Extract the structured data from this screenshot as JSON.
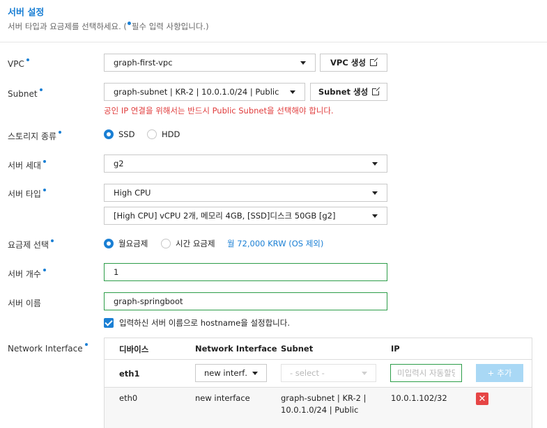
{
  "header": {
    "title": "서버 설정",
    "subtitle_pre": "서버 타입과 요금제를 선택하세요. (",
    "subtitle_post": "필수 입력 사항입니다.)"
  },
  "form": {
    "vpc": {
      "label": "VPC",
      "value": "graph-first-vpc",
      "create_button": "VPC 생성"
    },
    "subnet": {
      "label": "Subnet",
      "value": "graph-subnet | KR-2 | 10.0.1.0/24 | Public",
      "create_button": "Subnet 생성",
      "warning": "공인 IP 연결을 위해서는 반드시 Public Subnet을 선택해야 합니다."
    },
    "storage": {
      "label": "스토리지 종류",
      "options": [
        "SSD",
        "HDD"
      ],
      "selected": "SSD"
    },
    "generation": {
      "label": "서버 세대",
      "value": "g2"
    },
    "server_type": {
      "label": "서버 타입",
      "value": "High CPU",
      "spec_value": "[High CPU] vCPU 2개, 메모리 4GB, [SSD]디스크 50GB [g2]"
    },
    "billing": {
      "label": "요금제 선택",
      "options": [
        "월요금제",
        "시간 요금제"
      ],
      "selected": "월요금제",
      "price": "월 72,000 KRW (OS 제외)"
    },
    "server_count": {
      "label": "서버 개수",
      "value": "1"
    },
    "server_name": {
      "label": "서버 이름",
      "value": "graph-springboot",
      "hostname_checkbox_label": "입력하신 서버 이름으로 hostname을 설정합니다.",
      "hostname_checked": true
    },
    "network_interface": {
      "label": "Network Interface",
      "columns": [
        "디바이스",
        "Network Interface",
        "Subnet",
        "IP"
      ],
      "new_row": {
        "device": "eth1",
        "interface_select": "new interf…",
        "subnet_placeholder": "- select -",
        "ip_placeholder": "미입력시 자동할당",
        "add_button": "추가"
      },
      "rows": [
        {
          "device": "eth0",
          "interface": "new interface",
          "subnet_line1": "graph-subnet | KR-2 |",
          "subnet_line2": "10.0.1.0/24 | Public",
          "ip": "10.0.1.102/32"
        }
      ]
    }
  },
  "colors": {
    "accent": "#1a7fd4",
    "error": "#e03c3c",
    "valid_border": "#2c9d48",
    "delete": "#e64545"
  }
}
